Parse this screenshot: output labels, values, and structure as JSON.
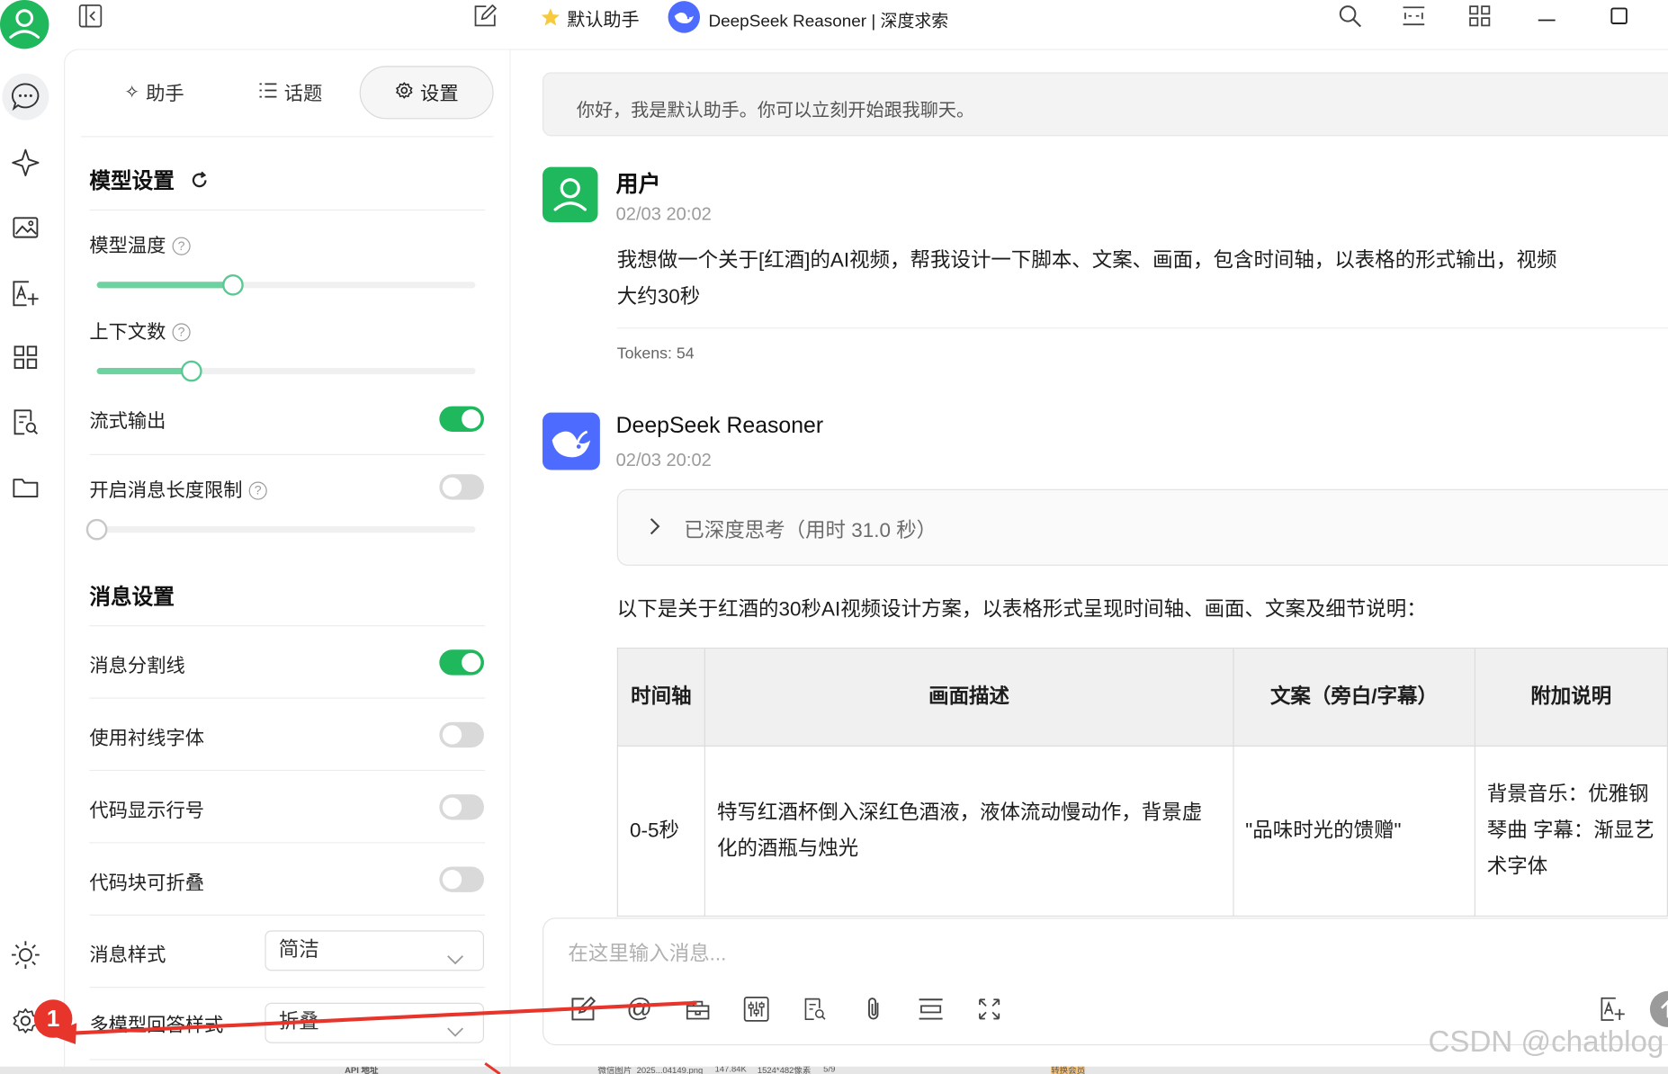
{
  "colors": {
    "accent": "#1fb85d",
    "slider": "#6cd3a0",
    "annotation": "#e8352c",
    "deepseek": "#4d6bfe"
  },
  "topbar": {
    "tabs": [
      {
        "label": "默认助手",
        "icon": "star-icon"
      },
      {
        "label": "DeepSeek Reasoner | 深度求索",
        "icon": "deepseek-logo-icon"
      }
    ]
  },
  "panel": {
    "tabs": [
      {
        "label": "助手",
        "icon": "sparkle-icon"
      },
      {
        "label": "话题",
        "icon": "list-icon"
      },
      {
        "label": "设置",
        "icon": "gear-icon",
        "active": true
      }
    ],
    "model_settings": {
      "title": "模型设置",
      "temperature_label": "模型温度",
      "temperature_level": 0.36,
      "context_label": "上下文数",
      "context_level": 0.25,
      "stream_label": "流式输出",
      "stream_on": true,
      "length_limit_label": "开启消息长度限制",
      "length_limit_on": false,
      "length_limit_level": 0
    },
    "message_settings": {
      "title": "消息设置",
      "rows": [
        {
          "label": "消息分割线",
          "on": true
        },
        {
          "label": "使用衬线字体",
          "on": false
        },
        {
          "label": "代码显示行号",
          "on": false
        },
        {
          "label": "代码块可折叠",
          "on": false
        }
      ],
      "style_label": "消息样式",
      "style_value": "简洁",
      "multi_label": "多模型回答样式",
      "multi_value": "折叠"
    }
  },
  "chat": {
    "greeting": "你好，我是默认助手。你可以立刻开始跟我聊天。",
    "user": {
      "name": "用户",
      "time": "02/03 20:02",
      "text_line1": "我想做一个关于[红酒]的AI视频，帮我设计一下脚本、文案、画面，包含时间轴，以表格的形式输出，视频",
      "text_line2": "大约30秒",
      "tokens": "Tokens: 54"
    },
    "bot": {
      "name": "DeepSeek Reasoner",
      "time": "02/03 20:02",
      "thinking": "已深度思考（用时 31.0 秒）",
      "intro": "以下是关于红酒的30秒AI视频设计方案，以表格形式呈现时间轴、画面、文案及细节说明："
    },
    "table": {
      "headers": [
        "时间轴",
        "画面描述",
        "文案（旁白/字幕）",
        "附加说明"
      ],
      "rows": [
        [
          "0-5秒",
          "特写红酒杯倒入深红色酒液，液体流动慢动作，背景虚化的酒瓶与烛光",
          "\"品味时光的馈赠\"",
          "背景音乐：优雅钢琴曲 字幕：渐显艺术字体"
        ]
      ]
    }
  },
  "input": {
    "placeholder": "在这里输入消息..."
  },
  "annotations": {
    "marker": "1",
    "watermark": "CSDN @chatblog"
  },
  "bottom_strip": {
    "texts": [
      "API 地址",
      "微信图片_2025...04149.png",
      "147.84K",
      "1524*482像素",
      "5/9",
      "转换会员"
    ]
  }
}
